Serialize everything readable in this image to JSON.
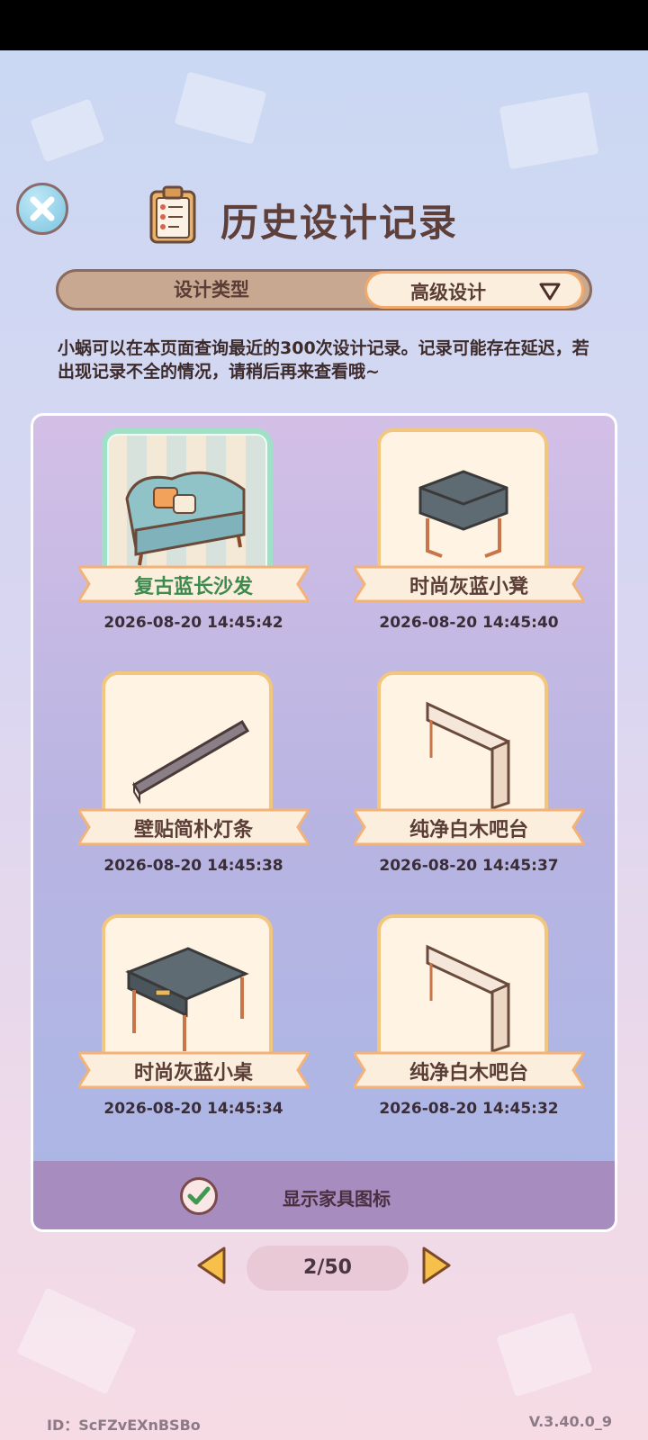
{
  "header": {
    "title": "历史设计记录"
  },
  "tabs": {
    "left_label": "设计类型",
    "right_label": "高级设计"
  },
  "notice": "小蜗可以在本页面查询最近的300次设计记录。记录可能存在延迟，若出现记录不全的情况，请稍后再来查看哦~",
  "records": [
    {
      "name": "复古蓝长沙发",
      "time": "2026-08-20 14:45:42",
      "icon": "blue-sofa-icon",
      "selected": true
    },
    {
      "name": "时尚灰蓝小凳",
      "time": "2026-08-20 14:45:40",
      "icon": "gray-stool-icon",
      "selected": false
    },
    {
      "name": "壁贴简朴灯条",
      "time": "2026-08-20 14:45:38",
      "icon": "light-strip-icon",
      "selected": false
    },
    {
      "name": "纯净白木吧台",
      "time": "2026-08-20 14:45:37",
      "icon": "white-bar-counter-icon",
      "selected": false
    },
    {
      "name": "时尚灰蓝小桌",
      "time": "2026-08-20 14:45:34",
      "icon": "gray-table-icon",
      "selected": false
    },
    {
      "name": "纯净白木吧台",
      "time": "2026-08-20 14:45:32",
      "icon": "white-bar-counter-icon",
      "selected": false
    }
  ],
  "footer_toggle": {
    "label": "显示家具图标",
    "checked": true
  },
  "pager": {
    "text": "2/50"
  },
  "account": {
    "id_text": "ID：ScFZvEXnBSBo",
    "version": "V.3.40.0_9"
  },
  "colors": {
    "title": "#5e3f3a",
    "panel": "#b8b4e2",
    "accent_orange": "#f2a96a",
    "selected_green": "#3e8a4e"
  }
}
